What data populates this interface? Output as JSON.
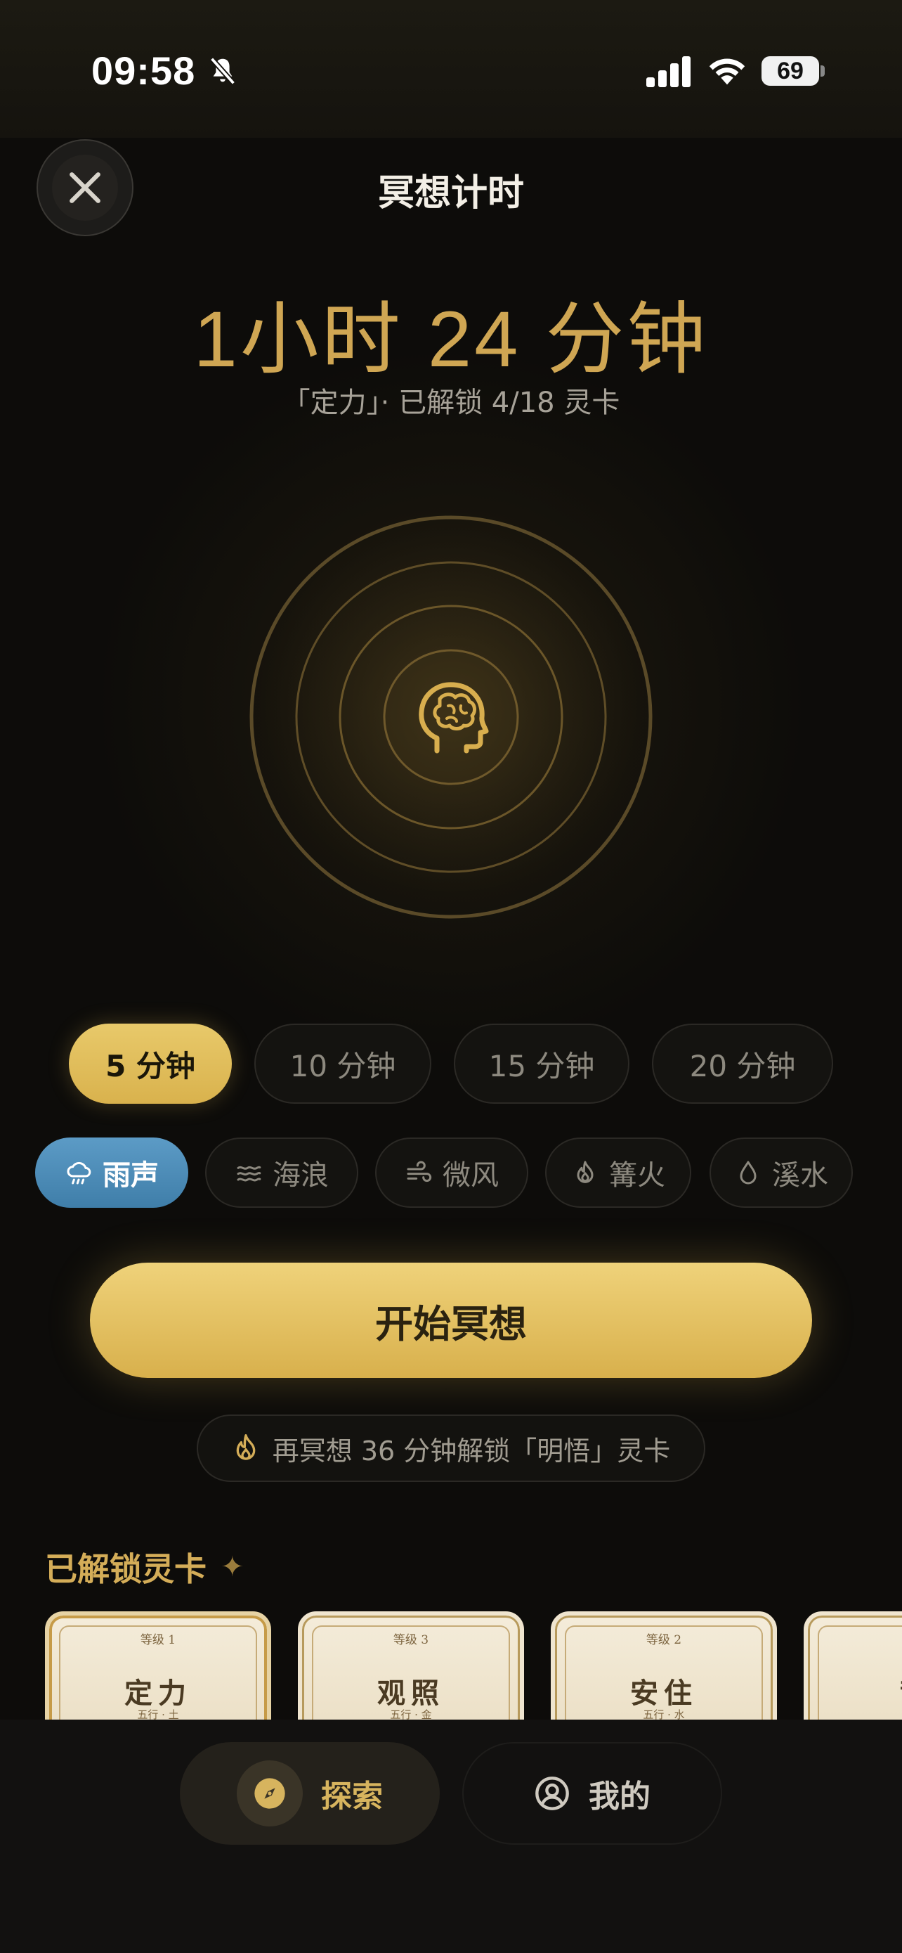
{
  "status_bar": {
    "time": "09:58",
    "battery": "69"
  },
  "header": {
    "title": "冥想计时",
    "close_icon": "close-icon"
  },
  "summary": {
    "total_time": "1小时 24 分钟",
    "subtitle": "「定力」· 已解锁 4/18 灵卡"
  },
  "durations": [
    {
      "label": "5 分钟",
      "selected": true
    },
    {
      "label": "10 分钟",
      "selected": false
    },
    {
      "label": "15 分钟",
      "selected": false
    },
    {
      "label": "20 分钟",
      "selected": false
    }
  ],
  "sounds": [
    {
      "label": "雨声",
      "icon": "rain-icon",
      "selected": true
    },
    {
      "label": "海浪",
      "icon": "waves-icon",
      "selected": false
    },
    {
      "label": "微风",
      "icon": "wind-icon",
      "selected": false
    },
    {
      "label": "篝火",
      "icon": "fire-icon",
      "selected": false
    },
    {
      "label": "溪水",
      "icon": "droplet-icon",
      "selected": false
    }
  ],
  "start_button": "开始冥想",
  "hint": "再冥想 36 分钟解锁「明悟」灵卡",
  "unlocked_section": {
    "title": "已解锁灵卡",
    "cards": [
      {
        "rank": "等级 1",
        "name": "定力",
        "element": "五行 · 土"
      },
      {
        "rank": "等级 3",
        "name": "观照",
        "element": "五行 · 金"
      },
      {
        "rank": "等级 2",
        "name": "安住",
        "element": "五行 · 水"
      },
      {
        "rank": "",
        "name": "龍",
        "element": ""
      }
    ]
  },
  "tabs": [
    {
      "label": "探索",
      "icon": "compass-icon",
      "active": true
    },
    {
      "label": "我的",
      "icon": "profile-icon",
      "active": false
    }
  ],
  "colors": {
    "gold": "#cfa653",
    "button_gold": "#e6c766",
    "sound_blue": "#4f8fbb",
    "background": "#0d0c0a"
  }
}
